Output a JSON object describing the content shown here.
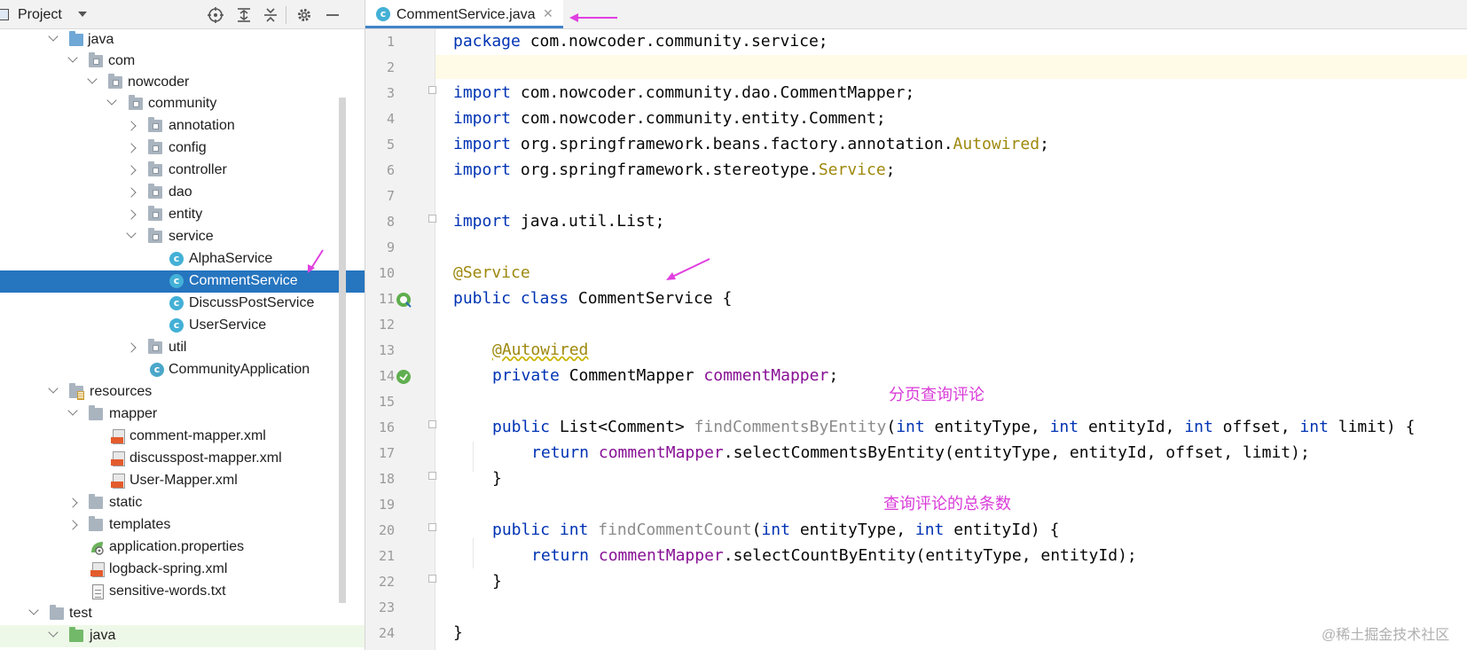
{
  "project_panel": {
    "title": "Project",
    "tree": [
      {
        "label": "java",
        "icon": "source-folder-icon",
        "expanded": true
      },
      {
        "label": "com",
        "icon": "package-folder-icon",
        "expanded": true
      },
      {
        "label": "nowcoder",
        "icon": "package-folder-icon",
        "expanded": true
      },
      {
        "label": "community",
        "icon": "package-folder-icon",
        "expanded": true
      },
      {
        "label": "annotation",
        "icon": "package-folder-icon",
        "expanded": false
      },
      {
        "label": "config",
        "icon": "package-folder-icon",
        "expanded": false
      },
      {
        "label": "controller",
        "icon": "package-folder-icon",
        "expanded": false
      },
      {
        "label": "dao",
        "icon": "package-folder-icon",
        "expanded": false
      },
      {
        "label": "entity",
        "icon": "package-folder-icon",
        "expanded": false
      },
      {
        "label": "service",
        "icon": "package-folder-icon",
        "expanded": true
      },
      {
        "label": "AlphaService",
        "icon": "java-class-icon"
      },
      {
        "label": "CommentService",
        "icon": "java-class-icon",
        "selected": true
      },
      {
        "label": "DiscussPostService",
        "icon": "java-class-icon"
      },
      {
        "label": "UserService",
        "icon": "java-class-icon"
      },
      {
        "label": "util",
        "icon": "package-folder-icon",
        "expanded": false
      },
      {
        "label": "CommunityApplication",
        "icon": "spring-boot-class-icon"
      },
      {
        "label": "resources",
        "icon": "resources-folder-icon",
        "expanded": true
      },
      {
        "label": "mapper",
        "icon": "folder-icon",
        "expanded": true
      },
      {
        "label": "comment-mapper.xml",
        "icon": "xml-file-icon"
      },
      {
        "label": "discusspost-mapper.xml",
        "icon": "xml-file-icon"
      },
      {
        "label": "User-Mapper.xml",
        "icon": "xml-file-icon"
      },
      {
        "label": "static",
        "icon": "folder-icon",
        "expanded": false
      },
      {
        "label": "templates",
        "icon": "folder-icon",
        "expanded": false
      },
      {
        "label": "application.properties",
        "icon": "properties-file-icon"
      },
      {
        "label": "logback-spring.xml",
        "icon": "xml-file-icon"
      },
      {
        "label": "sensitive-words.txt",
        "icon": "text-file-icon"
      },
      {
        "label": "test",
        "icon": "test-folder-icon",
        "expanded": true
      },
      {
        "label": "java",
        "icon": "test-source-folder-icon",
        "expanded": true
      }
    ]
  },
  "editor": {
    "tab_label": "CommentService.java",
    "tab_icon": "java-class-icon",
    "line_numbers": [
      "1",
      "2",
      "3",
      "4",
      "5",
      "6",
      "7",
      "8",
      "9",
      "10",
      "11",
      "12",
      "13",
      "14",
      "15",
      "16",
      "17",
      "18",
      "19",
      "20",
      "21",
      "22",
      "23",
      "24"
    ],
    "current_line": 2,
    "code": {
      "l1": {
        "kw": "package",
        "rest": " com.nowcoder.community.service;"
      },
      "l3": {
        "kw": "import",
        "rest": " com.nowcoder.community.dao.CommentMapper;"
      },
      "l4": {
        "kw": "import",
        "rest": " com.nowcoder.community.entity.Comment;"
      },
      "l5": {
        "kw": "import",
        "rest": " org.springframework.beans.factory.annotation.",
        "ann": "Autowired",
        "tail": ";"
      },
      "l6": {
        "kw": "import",
        "rest": " org.springframework.stereotype.",
        "ann": "Service",
        "tail": ";"
      },
      "l8": {
        "kw": "import",
        "rest": " java.util.List;"
      },
      "l10": {
        "ann": "@Service"
      },
      "l11": {
        "kw1": "public",
        "kw2": " class",
        "rest": " CommentService {"
      },
      "l13": {
        "ann": "@Autowired"
      },
      "l14": {
        "kw": "private",
        "type": " CommentMapper ",
        "field": "commentMapper",
        "tail": ";"
      },
      "l16": {
        "kw": "public",
        "type": " List<Comment> ",
        "method": "findCommentsByEntity",
        "p1": "(",
        "k1": "int",
        "a1": " entityType, ",
        "k2": "int",
        "a2": " entityId, ",
        "k3": "int",
        "a3": " offset, ",
        "k4": "int",
        "a4": " limit) {"
      },
      "l17": {
        "kw": "return",
        "field": " commentMapper",
        "rest": ".selectCommentsByEntity(entityType, entityId, offset, limit);"
      },
      "l18": {
        "rest": "}"
      },
      "l20": {
        "kw": "public",
        "k0": " int",
        "method": " findCommentCount",
        "p1": "(",
        "k1": "int",
        "a1": " entityType, ",
        "k2": "int",
        "a2": " entityId) {"
      },
      "l21": {
        "kw": "return",
        "field": " commentMapper",
        "rest": ".selectCountByEntity(entityType, entityId);"
      },
      "l22": {
        "rest": "}"
      },
      "l24": {
        "rest": "}"
      }
    }
  },
  "annotations": {
    "note1": "分页查询评论",
    "note2": "查询评论的总条数",
    "arrow_color": "#e040e0"
  },
  "watermark": "@稀土掘金技术社区",
  "colors": {
    "selection": "#2675bf",
    "keyword": "#0033b3",
    "annotation": "#9e880d",
    "field": "#871094",
    "note": "#d93bd9"
  }
}
